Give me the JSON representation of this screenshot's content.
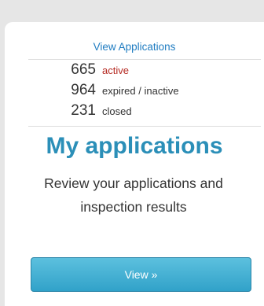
{
  "card": {
    "link_label": "View Applications",
    "stats": [
      {
        "count": "665",
        "label": "active"
      },
      {
        "count": "964",
        "label": "expired / inactive"
      },
      {
        "count": "231",
        "label": "closed"
      }
    ],
    "title": "My applications",
    "description": "Review your applications and inspection results",
    "button_label": "View »"
  },
  "colors": {
    "link": "#1f7cc1",
    "active_status": "#b52a22",
    "title": "#2b8fb8",
    "button_top": "#5cc0de",
    "button_bottom": "#31a2c9",
    "background": "#e6e6e6"
  }
}
